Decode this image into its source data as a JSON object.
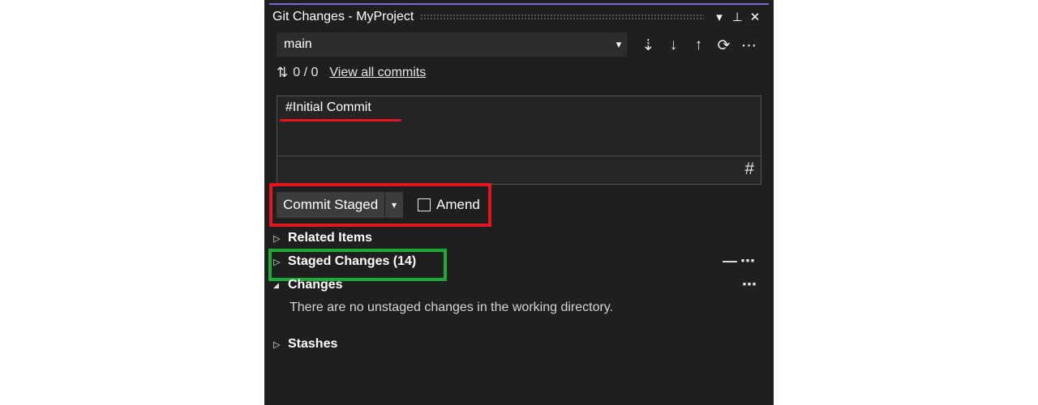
{
  "window": {
    "title": "Git Changes - MyProject",
    "icons": [
      "dropdown-icon",
      "pin-icon",
      "close-icon"
    ],
    "glyphs": {
      "dropdown": "▾",
      "pin": "⊥",
      "close": "✕"
    }
  },
  "branch": {
    "name": "main",
    "caret": "▾",
    "sync_icons": [
      "fetch-icon",
      "pull-icon",
      "push-icon",
      "sync-icon",
      "more-icon"
    ],
    "sync_glyphs": {
      "fetch": "⇣",
      "pull": "↓",
      "push": "↑",
      "sync": "⟳",
      "more": "⋯"
    }
  },
  "commits": {
    "arrows": "⇅",
    "count": "0 / 0",
    "view_all_label": "View all commits"
  },
  "message": {
    "text": "#Initial Commit",
    "hash_glyph": "#"
  },
  "commit": {
    "button_label": "Commit Staged",
    "dropdown_glyph": "▾",
    "amend_label": "Amend",
    "amend_checked": false
  },
  "sections": {
    "related_items": {
      "label": "Related Items",
      "expanded": false
    },
    "staged_changes": {
      "label": "Staged Changes (14)",
      "expanded": false
    },
    "changes": {
      "label": "Changes",
      "expanded": true,
      "empty_message": "There are no unstaged changes in the working directory."
    },
    "stashes": {
      "label": "Stashes",
      "expanded": false
    }
  },
  "glyphs": {
    "collapsed": "▷",
    "expanded": "◢",
    "minus": "—",
    "more": "⋯"
  },
  "annotations": {
    "red": "#e3151f",
    "green": "#1aab36"
  },
  "colors": {
    "panel_bg": "#1f1f1f",
    "accent": "#7a66d6"
  }
}
